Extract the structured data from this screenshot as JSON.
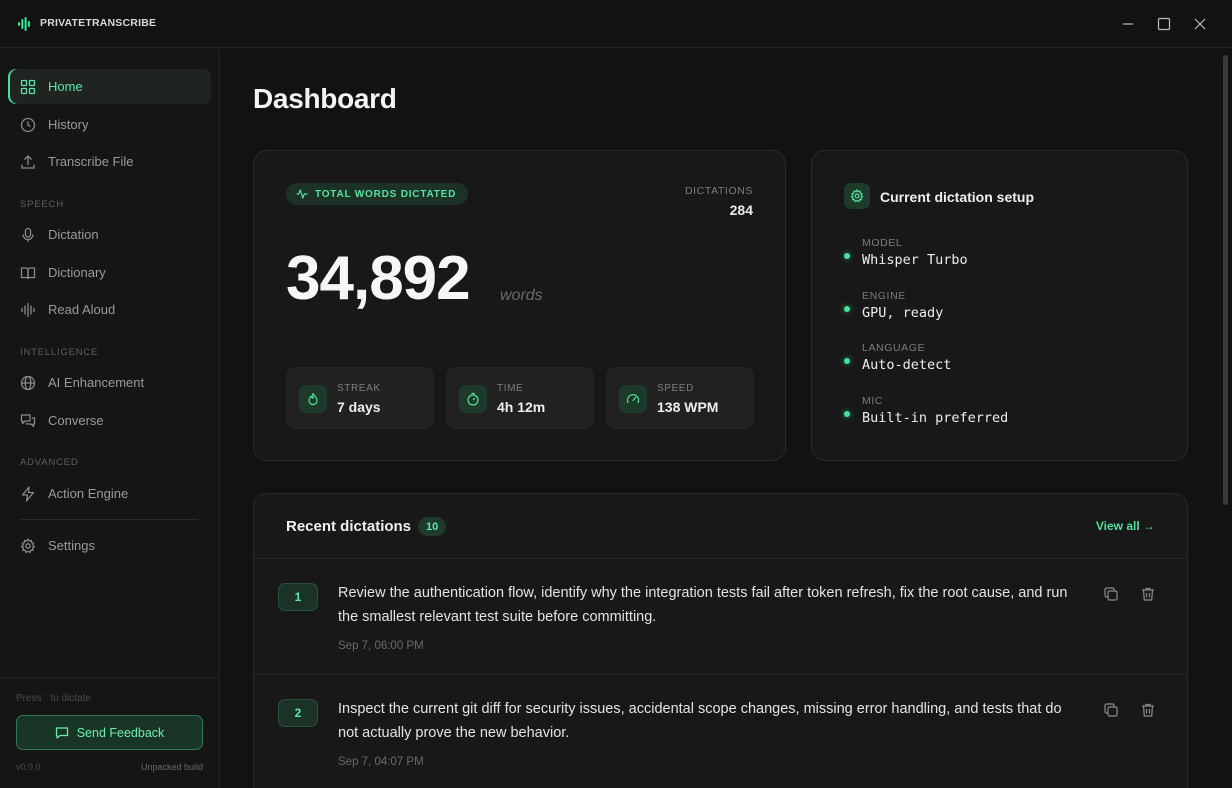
{
  "app": {
    "name": "PRIVATETRANSCRIBE"
  },
  "sidebar": {
    "items": [
      {
        "label": "Home"
      },
      {
        "label": "History"
      },
      {
        "label": "Transcribe File"
      }
    ],
    "sections": [
      {
        "label": "SPEECH",
        "items": [
          {
            "label": "Dictation"
          },
          {
            "label": "Dictionary"
          },
          {
            "label": "Read Aloud"
          }
        ]
      },
      {
        "label": "INTELLIGENCE",
        "items": [
          {
            "label": "AI Enhancement"
          },
          {
            "label": "Converse"
          }
        ]
      },
      {
        "label": "ADVANCED",
        "items": [
          {
            "label": "Action Engine"
          }
        ]
      }
    ],
    "settings_label": "Settings",
    "hint": "Press ` to dictate",
    "feedback_label": "Send Feedback",
    "version": "v0.9.0",
    "build": "Unpacked build"
  },
  "page": {
    "title": "Dashboard"
  },
  "stats": {
    "pill_label": "TOTAL WORDS DICTATED",
    "dictations_label": "DICTATIONS",
    "dictations_value": "284",
    "total_words": "34,892",
    "unit": "words",
    "mini": [
      {
        "label": "STREAK",
        "value": "7 days"
      },
      {
        "label": "TIME",
        "value": "4h 12m"
      },
      {
        "label": "SPEED",
        "value": "138 WPM"
      }
    ]
  },
  "setup": {
    "title": "Current dictation setup",
    "items": [
      {
        "label": "MODEL",
        "value": "Whisper Turbo"
      },
      {
        "label": "ENGINE",
        "value": "GPU, ready"
      },
      {
        "label": "LANGUAGE",
        "value": "Auto-detect"
      },
      {
        "label": "MIC",
        "value": "Built-in preferred"
      }
    ]
  },
  "recent": {
    "title": "Recent dictations",
    "count": "10",
    "view_all": "View all →",
    "rows": [
      {
        "num": "1",
        "text": "Review the authentication flow, identify why the integration tests fail after token refresh, fix the root cause, and run the smallest relevant test suite before committing.",
        "time": "Sep 7, 06:00 PM"
      },
      {
        "num": "2",
        "text": "Inspect the current git diff for security issues, accidental scope changes, missing error handling, and tests that do not actually prove the new behavior.",
        "time": "Sep 7, 04:07 PM"
      }
    ]
  },
  "colors": {
    "accent": "#3ee69a",
    "background": "#121212",
    "card": "#181818"
  }
}
